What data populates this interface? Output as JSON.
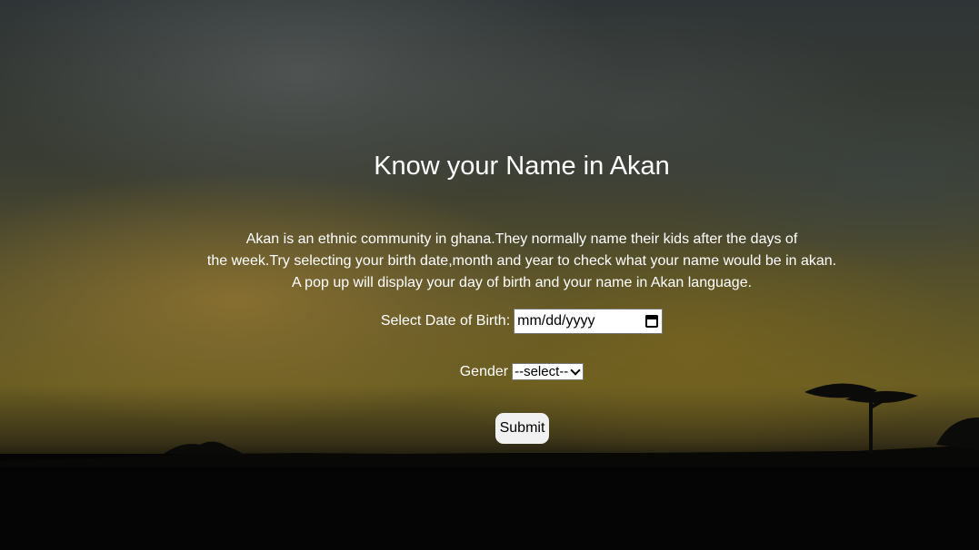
{
  "page": {
    "title": "Know your Name in Akan",
    "intro_lines": [
      "Akan is an ethnic community in ghana.They normally name their kids after the days of",
      "the week.Try selecting your birth date,month and year to check what your name would be in akan.",
      "A pop up will display your day of birth and your name in Akan language."
    ]
  },
  "form": {
    "dob_label": "Select Date of Birth:",
    "dob_placeholder": "mm/dd/yyyy",
    "gender_label": "Gender",
    "gender_selected": "--select--",
    "submit_label": "Submit"
  },
  "icons": {
    "date_picker": "calendar-icon",
    "select_dropdown": "chevron-down-icon"
  },
  "colors": {
    "text": "#ffffff",
    "ground": "#050505"
  }
}
